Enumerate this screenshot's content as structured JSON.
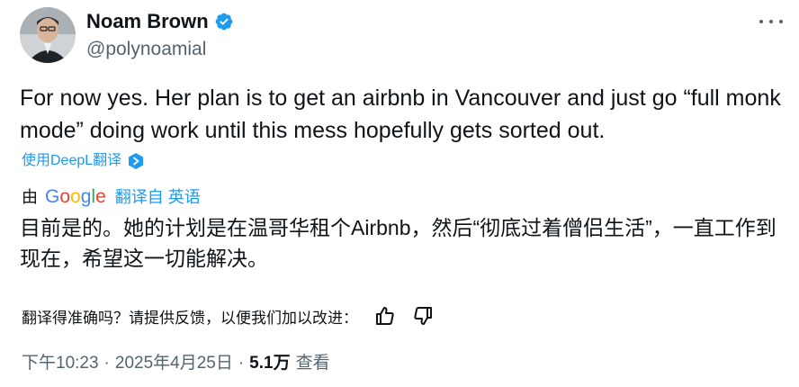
{
  "author": {
    "name": "Noam Brown",
    "handle": "@polynoamial",
    "verified": true
  },
  "tweet": {
    "text_en": "For now yes. Her plan is to get an airbnb in Vancouver and just go “full monk mode” doing work until this mess hopefully gets sorted out.",
    "deepl_label": "使用DeepL翻译",
    "translated_by_prefix": "由",
    "translated_by_brand": "Google",
    "translate_from_label": "翻译自 英语",
    "text_zh": "目前是的。她的计划是在温哥华租个Airbnb，然后“彻底过着僧侣生活”，一直工作到现在，希望这一切能解决。",
    "feedback_prompt": "翻译得准确吗？请提供反馈，以便我们加以改进："
  },
  "meta": {
    "time": "下午10:23",
    "date": "2025年4月25日",
    "views_count": "5.1万",
    "views_label": "查看"
  },
  "colors": {
    "link": "#1d9bf0",
    "secondary": "#536471",
    "primary_text": "#0f1419"
  },
  "icons": {
    "verified": "verified-badge-icon",
    "more": "more-horizontal-icon",
    "deepl": "deepl-icon",
    "thumbs_up": "thumbs-up-icon",
    "thumbs_down": "thumbs-down-icon"
  }
}
